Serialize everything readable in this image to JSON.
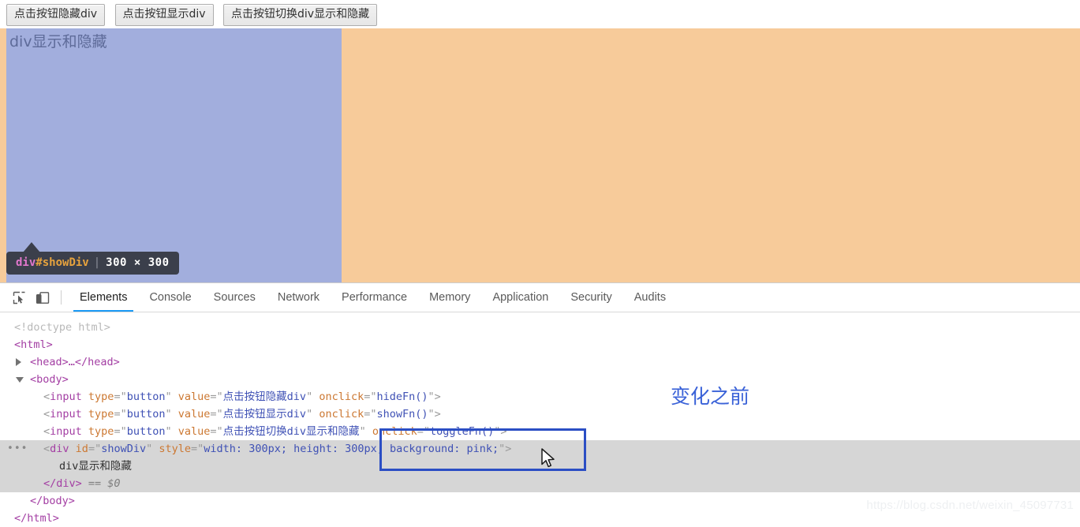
{
  "page": {
    "buttons": [
      {
        "label": "点击按钮隐藏div"
      },
      {
        "label": "点击按钮显示div"
      },
      {
        "label": "点击按钮切换div显示和隐藏"
      }
    ],
    "div_text": "div显示和隐藏",
    "highlight": {
      "content_color": "#a2aedd",
      "margin_color": "#f7cb9a"
    }
  },
  "element_badge": {
    "tag": "div",
    "id": "#showDiv",
    "separator": "|",
    "dimensions": "300 × 300",
    "background": "#3b3f4b",
    "tag_color": "#e277cd",
    "id_color": "#e8a33d"
  },
  "devtools": {
    "icons": {
      "inspect": "inspect-cursor-icon",
      "device": "device-toolbar-icon"
    },
    "tabs": [
      {
        "label": "Elements",
        "active": true
      },
      {
        "label": "Console",
        "active": false
      },
      {
        "label": "Sources",
        "active": false
      },
      {
        "label": "Network",
        "active": false
      },
      {
        "label": "Performance",
        "active": false
      },
      {
        "label": "Memory",
        "active": false
      },
      {
        "label": "Application",
        "active": false
      },
      {
        "label": "Security",
        "active": false
      },
      {
        "label": "Audits",
        "active": false
      }
    ],
    "active_tab_underline_color": "#1a9af5",
    "dom": {
      "doctype": "<!doctype html>",
      "html_open": "<html>",
      "head_collapsed": "<head>…</head>",
      "body_open": "<body>",
      "inputs": [
        {
          "tag": "input",
          "attrs": [
            {
              "name": "type",
              "value": "button"
            },
            {
              "name": "value",
              "value": "点击按钮隐藏div"
            },
            {
              "name": "onclick",
              "value": "hideFn()"
            }
          ]
        },
        {
          "tag": "input",
          "attrs": [
            {
              "name": "type",
              "value": "button"
            },
            {
              "name": "value",
              "value": "点击按钮显示div"
            },
            {
              "name": "onclick",
              "value": "showFn()"
            }
          ]
        },
        {
          "tag": "input",
          "attrs": [
            {
              "name": "type",
              "value": "button"
            },
            {
              "name": "value",
              "value": "点击按钮切换div显示和隐藏"
            },
            {
              "name": "onclick",
              "value": "toggleFn()"
            }
          ]
        }
      ],
      "selected_div": {
        "ellipsis": "•••",
        "tag": "div",
        "attr_id_name": "id",
        "attr_id_value": "showDiv",
        "attr_style_name": "style",
        "attr_style_value": "width: 300px; height: 300px; background: pink;",
        "text_child": "div显示和隐藏",
        "close_tag": "</div>",
        "console_ref": "== $0"
      },
      "body_close": "</body>",
      "html_close": "</html>"
    }
  },
  "annotations": {
    "note_text": "变化之前",
    "note_color": "#3a62d8",
    "rect_color": "#2b4ec4",
    "watermark": "https://blog.csdn.net/weixin_45097731"
  }
}
